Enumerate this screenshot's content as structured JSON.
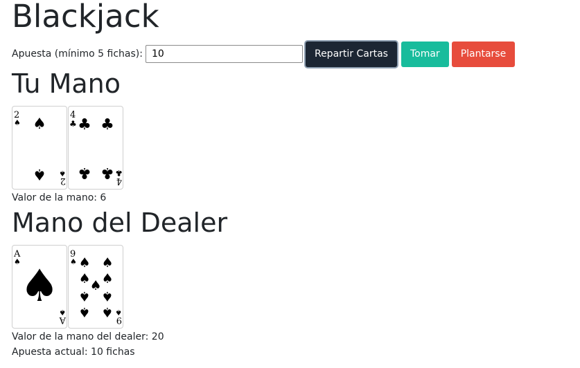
{
  "title": "Blackjack",
  "bet": {
    "label": "Apuesta (mínimo 5 fichas):",
    "value": "10"
  },
  "buttons": {
    "deal": "Repartir Cartas",
    "hit": "Tomar",
    "stand": "Plantarse"
  },
  "colors": {
    "deal": "#1c2633",
    "hit": "#18bc9c",
    "stand": "#e74c3c"
  },
  "player": {
    "heading": "Tu Mano",
    "cards": [
      {
        "rank": "2",
        "suit": "spades"
      },
      {
        "rank": "4",
        "suit": "clubs"
      }
    ],
    "value_text": "Valor de la mano: 6"
  },
  "dealer": {
    "heading": "Mano del Dealer",
    "cards": [
      {
        "rank": "A",
        "suit": "spades"
      },
      {
        "rank": "9",
        "suit": "spades"
      }
    ],
    "value_text": "Valor de la mano del dealer: 20"
  },
  "current_bet_text": "Apuesta actual: 10 fichas"
}
